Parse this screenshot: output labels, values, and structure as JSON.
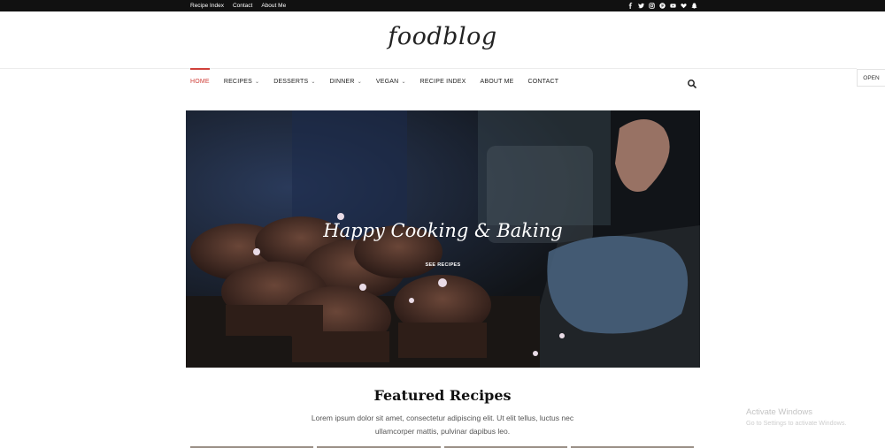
{
  "topbar": {
    "links": [
      "Recipe Index",
      "Contact",
      "About Me"
    ],
    "social_icons": [
      "facebook-icon",
      "twitter-icon",
      "instagram-icon",
      "pinterest-icon",
      "youtube-icon",
      "heart-icon",
      "snapchat-icon"
    ]
  },
  "logo": "foodblog",
  "nav": {
    "items": [
      {
        "label": "HOME",
        "active": true,
        "dropdown": false
      },
      {
        "label": "RECIPES",
        "active": false,
        "dropdown": true
      },
      {
        "label": "DESSERTS",
        "active": false,
        "dropdown": true
      },
      {
        "label": "DINNER",
        "active": false,
        "dropdown": true
      },
      {
        "label": "VEGAN",
        "active": false,
        "dropdown": true
      },
      {
        "label": "RECIPE INDEX",
        "active": false,
        "dropdown": false
      },
      {
        "label": "ABOUT ME",
        "active": false,
        "dropdown": false
      },
      {
        "label": "CONTACT",
        "active": false,
        "dropdown": false
      }
    ],
    "search_icon": "search-icon",
    "accent": "#d0403a"
  },
  "side_tab": "OPEN",
  "hero": {
    "title": "Happy Cooking & Baking",
    "button": "SEE RECIPES"
  },
  "featured": {
    "title": "Featured Recipes",
    "description": "Lorem ipsum dolor sit amet, consectetur adipiscing elit. Ut elit tellus, luctus nec ullamcorper mattis, pulvinar dapibus leo."
  },
  "watermark": {
    "title": "Activate Windows",
    "subtitle": "Go to Settings to activate Windows."
  }
}
